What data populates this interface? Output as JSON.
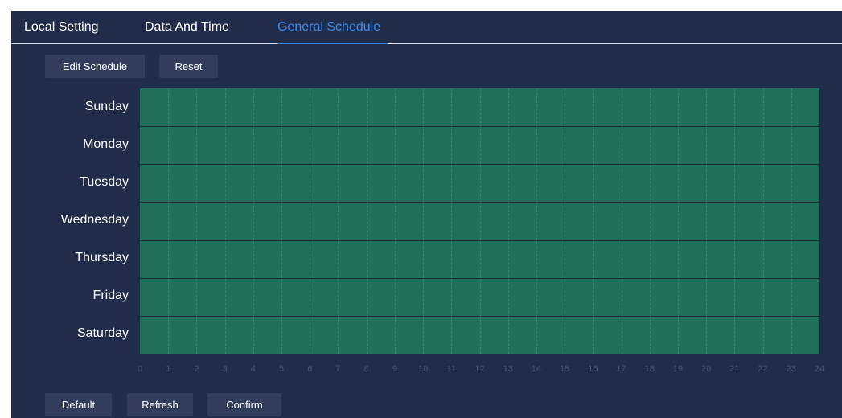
{
  "tabs": [
    {
      "label": "Local Setting",
      "active": false
    },
    {
      "label": "Data And Time",
      "active": false
    },
    {
      "label": "General Schedule",
      "active": true
    }
  ],
  "toolbar": {
    "edit_label": "Edit Schedule",
    "reset_label": "Reset"
  },
  "schedule": {
    "days": [
      "Sunday",
      "Monday",
      "Tuesday",
      "Wednesday",
      "Thursday",
      "Friday",
      "Saturday"
    ],
    "hours": [
      "0",
      "1",
      "2",
      "3",
      "4",
      "5",
      "6",
      "7",
      "8",
      "9",
      "10",
      "11",
      "12",
      "13",
      "14",
      "15",
      "16",
      "17",
      "18",
      "19",
      "20",
      "21",
      "22",
      "23",
      "24"
    ],
    "fill_color": "#20705a",
    "all_hours_selected": true
  },
  "footer": {
    "default_label": "Default",
    "refresh_label": "Refresh",
    "confirm_label": "Confirm"
  },
  "colors": {
    "background": "#212b4a",
    "accent": "#3c8ce8",
    "button": "#323d5e"
  }
}
